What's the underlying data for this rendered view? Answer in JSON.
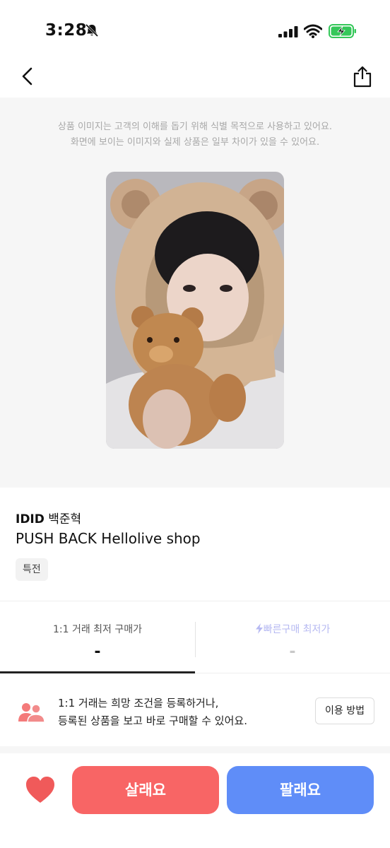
{
  "status_bar": {
    "time": "3:28",
    "icons": [
      "bell-muted-icon",
      "cellular-signal-icon",
      "wifi-icon",
      "battery-charging-icon"
    ],
    "battery_color": "#34c759"
  },
  "header": {
    "icons": [
      "back-chevron-icon",
      "share-icon"
    ]
  },
  "image_section": {
    "notice_line1": "상품 이미지는 고객의 이해를 돕기 위해 식별 목적으로 사용하고 있어요.",
    "notice_line2": "화면에 보이는 이미지와 실제 상품은 일부 차이가 있을 수 있어요."
  },
  "product": {
    "artist_group": "IDID",
    "member": "백준혁",
    "title": "PUSH BACK Hellolive shop",
    "tag": "특전"
  },
  "tabs": [
    {
      "label": "1:1 거래 최저 구매가",
      "value": "-",
      "active": true
    },
    {
      "label": "빠른구매 최저가",
      "value": "-",
      "active": false,
      "icon": "lightning-icon"
    }
  ],
  "info": {
    "line1": "1:1 거래는 희망 조건을 등록하거나,",
    "line2": "등록된 상품을 보고 바로 구매할 수 있어요.",
    "button": "이용 방법",
    "icon": "people-icon"
  },
  "actions": {
    "buy": "살래요",
    "sell": "팔래요",
    "favorite_icon": "heart-icon"
  },
  "colors": {
    "buy": "#f86565",
    "sell": "#5f8df8",
    "heart": "#f05a5a",
    "people_icon": "#f47a7a",
    "inactive_tab": "#b6b9f2"
  }
}
